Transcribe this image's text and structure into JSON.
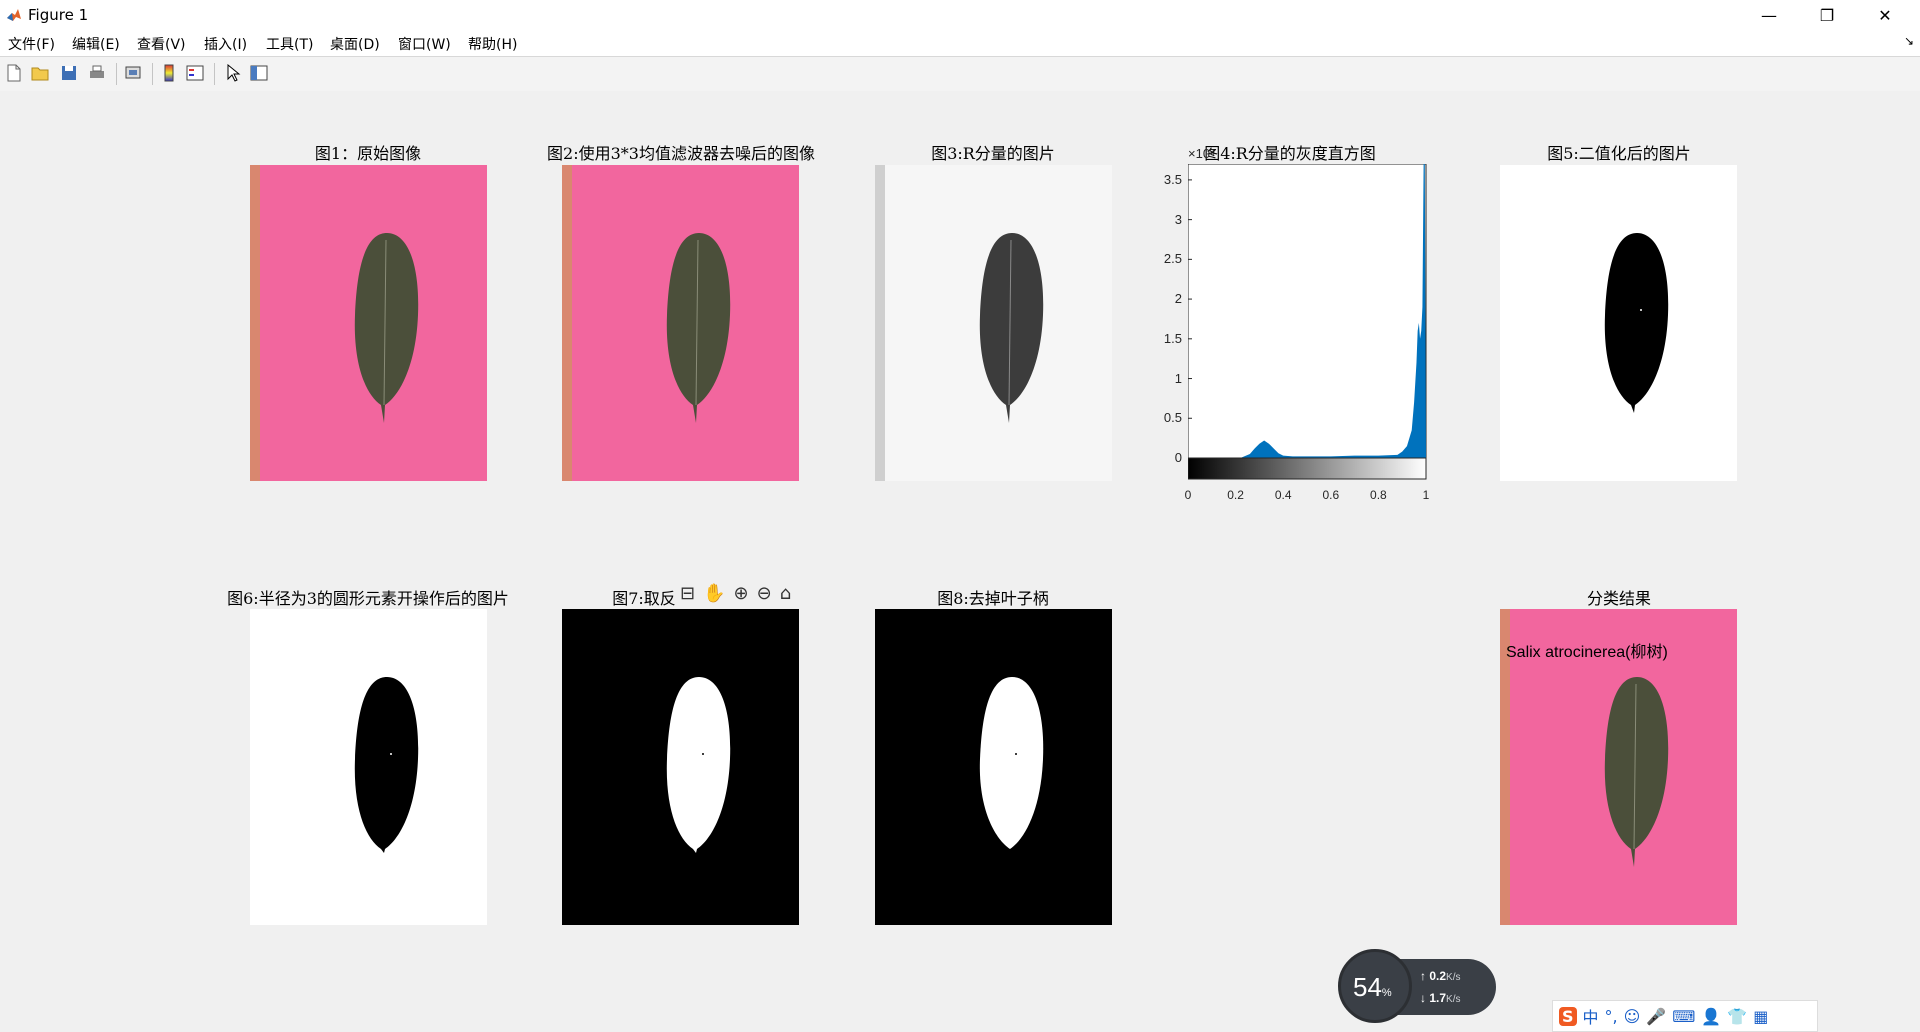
{
  "window": {
    "title": "Figure 1",
    "minimize": "—",
    "restore": "❐",
    "close": "✕"
  },
  "menu": {
    "items": [
      "文件(F)",
      "编辑(E)",
      "查看(V)",
      "插入(I)",
      "工具(T)",
      "桌面(D)",
      "窗口(W)",
      "帮助(H)"
    ],
    "overflow": "↘"
  },
  "toolbar": {
    "icons": [
      "new-figure-icon",
      "open-file-icon",
      "save-icon",
      "print-icon",
      "print-preview-icon",
      "colorbar-icon",
      "legend-icon",
      "pointer-icon",
      "property-editor-icon"
    ]
  },
  "panels": {
    "p1": {
      "title": "图1：原始图像"
    },
    "p2": {
      "title": "图2:使用3*3均值滤波器去噪后的图像"
    },
    "p3": {
      "title": "图3:R分量的图片"
    },
    "p4": {
      "title": "图4:R分量的灰度直方图",
      "exponent": "×10⁴"
    },
    "p5": {
      "title": "图5:二值化后的图片"
    },
    "p6": {
      "title": "图6:半径为3的圆形元素开操作后的图片"
    },
    "p7": {
      "title": "图7:取反"
    },
    "p8": {
      "title": "图8:去掉叶子柄"
    },
    "p9": {
      "title": "分类结果",
      "label": "Salix atrocinerea(柳树)"
    }
  },
  "axes_toolbar": {
    "icons": [
      "export-icon",
      "pan-hand-icon",
      "zoom-in-icon",
      "zoom-out-icon",
      "home-icon"
    ]
  },
  "chart_data": {
    "type": "area",
    "title": "图4:R分量的灰度直方图",
    "xlabel": "",
    "ylabel": "",
    "xlim": [
      0,
      1
    ],
    "ylim": [
      0,
      3.7
    ],
    "y_scale_factor": "×10⁴",
    "x_ticks": [
      "0",
      "0.2",
      "0.4",
      "0.6",
      "0.8",
      "1"
    ],
    "y_ticks": [
      "0",
      "0.5",
      "1",
      "1.5",
      "2",
      "2.5",
      "3",
      "3.5"
    ],
    "series": [
      {
        "color": "#0072bd",
        "x": [
          0.22,
          0.26,
          0.28,
          0.3,
          0.32,
          0.34,
          0.36,
          0.38,
          0.4,
          0.44,
          0.5,
          0.6,
          0.7,
          0.8,
          0.88,
          0.9,
          0.92,
          0.94,
          0.95,
          0.96,
          0.965,
          0.97,
          0.975,
          0.98,
          0.985,
          0.99,
          0.995,
          1.0
        ],
        "y": [
          0.0,
          0.05,
          0.12,
          0.18,
          0.22,
          0.18,
          0.12,
          0.06,
          0.03,
          0.02,
          0.02,
          0.02,
          0.03,
          0.03,
          0.04,
          0.08,
          0.15,
          0.35,
          0.7,
          1.2,
          1.6,
          1.7,
          1.5,
          1.6,
          1.9,
          3.7,
          3.7,
          0.0
        ]
      }
    ]
  },
  "netmon": {
    "percent": "54",
    "percent_unit": "%",
    "up": "0.2",
    "down": "1.7",
    "unit": "K/s"
  },
  "ime": {
    "lang": "中",
    "punct": "°,",
    "icons": [
      "emoji-icon",
      "mic-icon",
      "keyboard-icon",
      "user-icon",
      "shirt-icon",
      "grid-icon"
    ]
  }
}
